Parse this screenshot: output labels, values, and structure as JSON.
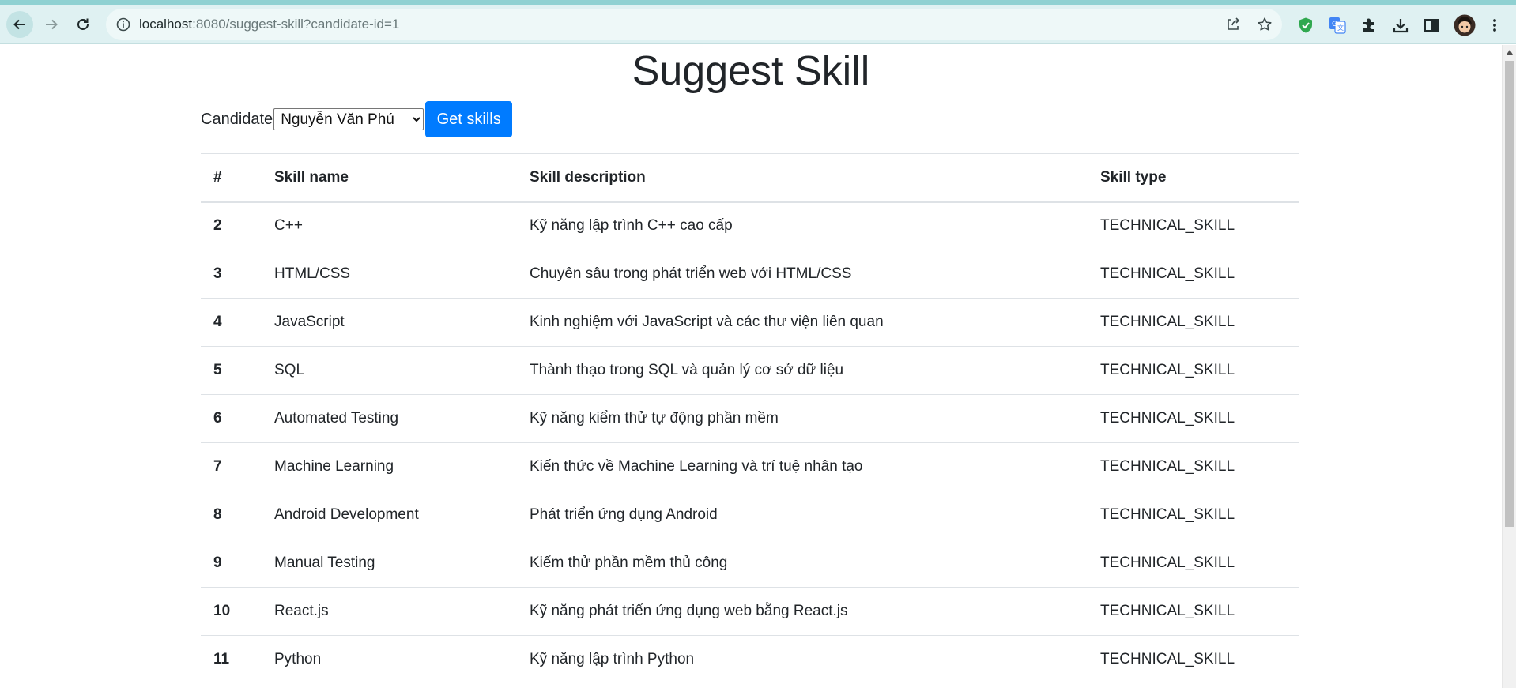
{
  "browser": {
    "url_host": "localhost",
    "url_rest": ":8080/suggest-skill?candidate-id=1",
    "icons": [
      "back-icon",
      "forward-icon",
      "reload-icon",
      "info-icon",
      "share-icon",
      "star-icon",
      "shield-extension-icon",
      "translate-extension-icon",
      "puzzle-extensions-icon",
      "download-icon",
      "side-panel-icon",
      "profile-avatar",
      "menu-icon"
    ],
    "colors": {
      "toolbar": "#dff1f2",
      "accent": "#8fd1d2"
    }
  },
  "page": {
    "title": "Suggest Skill",
    "candidate_label": "Candidate",
    "candidate_selected": "Nguyễn Văn Phú",
    "get_skills_label": "Get skills",
    "button_color": "#007bff"
  },
  "table": {
    "headers": [
      "#",
      "Skill name",
      "Skill description",
      "Skill type"
    ],
    "rows": [
      [
        "2",
        "C++",
        "Kỹ năng lập trình C++ cao cấp",
        "TECHNICAL_SKILL"
      ],
      [
        "3",
        "HTML/CSS",
        "Chuyên sâu trong phát triển web với HTML/CSS",
        "TECHNICAL_SKILL"
      ],
      [
        "4",
        "JavaScript",
        "Kinh nghiệm với JavaScript và các thư viện liên quan",
        "TECHNICAL_SKILL"
      ],
      [
        "5",
        "SQL",
        "Thành thạo trong SQL và quản lý cơ sở dữ liệu",
        "TECHNICAL_SKILL"
      ],
      [
        "6",
        "Automated Testing",
        "Kỹ năng kiểm thử tự động phần mềm",
        "TECHNICAL_SKILL"
      ],
      [
        "7",
        "Machine Learning",
        "Kiến thức về Machine Learning và trí tuệ nhân tạo",
        "TECHNICAL_SKILL"
      ],
      [
        "8",
        "Android Development",
        "Phát triển ứng dụng Android",
        "TECHNICAL_SKILL"
      ],
      [
        "9",
        "Manual Testing",
        "Kiểm thử phần mềm thủ công",
        "TECHNICAL_SKILL"
      ],
      [
        "10",
        "React.js",
        "Kỹ năng phát triển ứng dụng web bằng React.js",
        "TECHNICAL_SKILL"
      ],
      [
        "11",
        "Python",
        "Kỹ năng lập trình Python",
        "TECHNICAL_SKILL"
      ]
    ]
  }
}
